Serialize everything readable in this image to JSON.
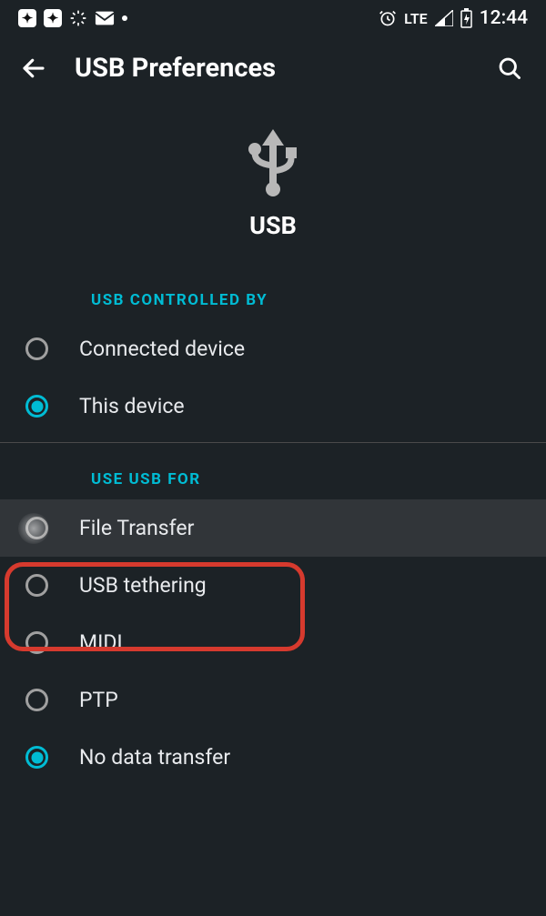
{
  "status": {
    "network_label": "LTE",
    "clock": "12:44"
  },
  "appbar": {
    "title": "USB Preferences"
  },
  "hero": {
    "label": "USB"
  },
  "sections": {
    "controlled_by": {
      "header": "USB CONTROLLED BY",
      "options": [
        {
          "label": "Connected device",
          "checked": false
        },
        {
          "label": "This device",
          "checked": true
        }
      ]
    },
    "use_for": {
      "header": "USE USB FOR",
      "options": [
        {
          "label": "File Transfer",
          "checked": false,
          "highlighted": true
        },
        {
          "label": "USB tethering",
          "checked": false
        },
        {
          "label": "MIDI",
          "checked": false
        },
        {
          "label": "PTP",
          "checked": false
        },
        {
          "label": "No data transfer",
          "checked": true
        }
      ]
    }
  }
}
